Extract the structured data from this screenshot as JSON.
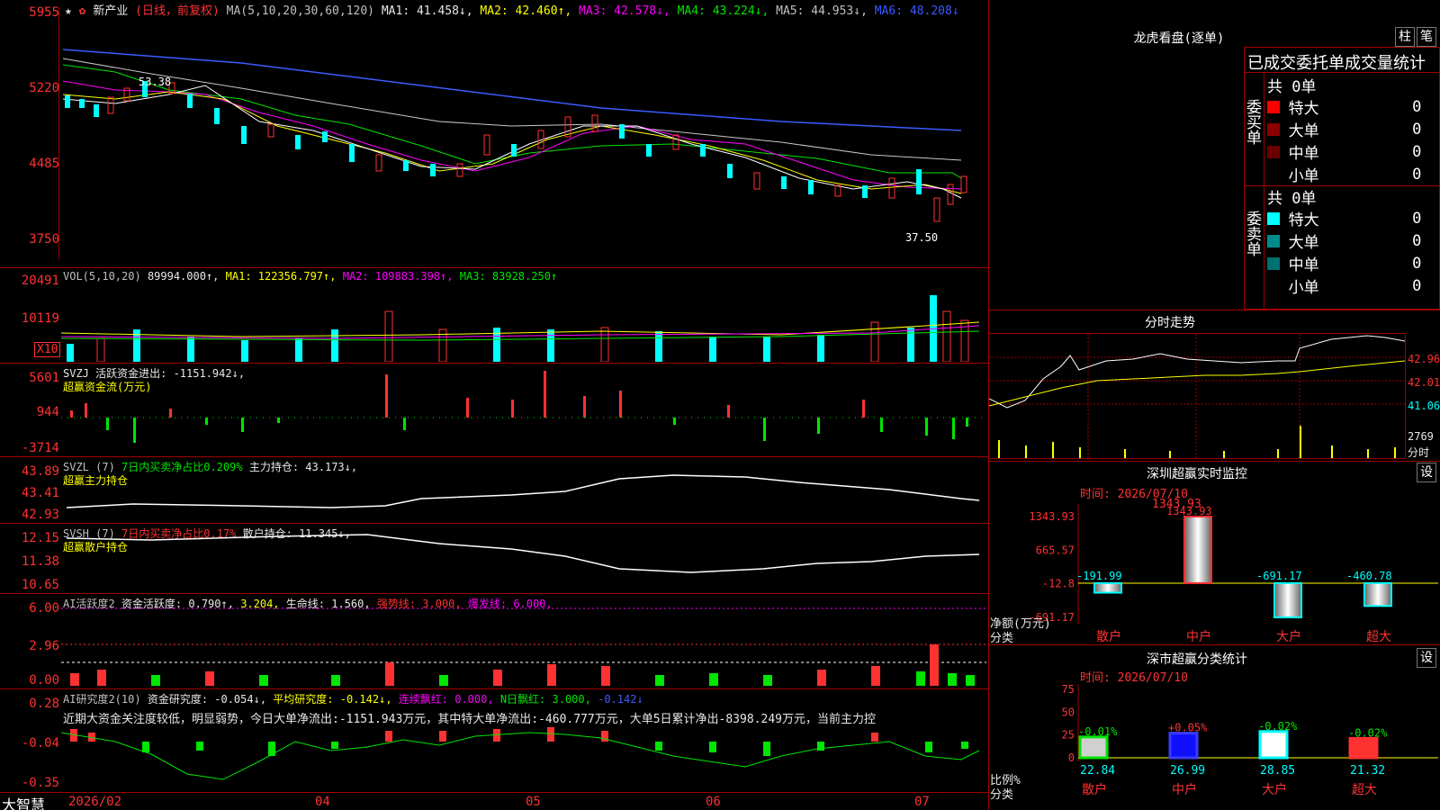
{
  "main_chart": {
    "star_icon": "★",
    "flag_icon": "✿",
    "stock_name": "新产业",
    "period": "(日线，前复权)",
    "ma_label": "MA(5,10,20,30,60,120)",
    "ma1": "MA1: 41.458↓,",
    "ma2": "MA2: 42.460↑,",
    "ma3": "MA3: 42.578↓,",
    "ma4": "MA4: 43.224↓,",
    "ma5": "MA5: 44.953↓,",
    "ma6": "MA6: 48.208↓",
    "y_ticks": [
      "5955",
      "5220",
      "4485",
      "3750"
    ],
    "high_mark": "53.38",
    "low_mark": "37.50"
  },
  "vol": {
    "label": "VOL(5,10,20)",
    "value": "89994.000↑,",
    "ma1": "MA1: 122356.797↑,",
    "ma2": "MA2: 109883.398↑,",
    "ma3": "MA3: 83928.250↑",
    "y_ticks": [
      "20491",
      "10119"
    ],
    "unit": "X10"
  },
  "svzj": {
    "label": "SVZJ  活跃资金进出: -1151.942↓,",
    "name": "超赢资金流(万元)",
    "y_ticks": [
      "5601",
      "944",
      "-3714"
    ]
  },
  "svzl": {
    "label": "SVZL (7)",
    "pct": "7日内买卖净占比0.209%",
    "hold": "主力持仓: 43.173↓,",
    "name": "超赢主力持仓",
    "y_ticks": [
      "43.89",
      "43.41",
      "42.93"
    ]
  },
  "svsh": {
    "label": "SVSH (7)",
    "pct": "7日内买卖净占比0.17%",
    "hold": "散户持仓: 11.345↓,",
    "name": "超赢散户持仓",
    "y_ticks": [
      "12.15",
      "11.38",
      "10.65"
    ]
  },
  "ai_active": {
    "label": "AI活跃度2",
    "active": "资金活跃度: 0.790↑,",
    "v2": "3.204,",
    "life": "生命线: 1.560,",
    "strong": "强势线: 3.000,",
    "burst": "爆发线: 6.000,",
    "y_ticks": [
      "6.00",
      "2.96",
      "0.00"
    ]
  },
  "ai_research": {
    "label": "AI研究度2(10)",
    "research": "资金研究度: -0.054↓,",
    "avg": "平均研究度: -0.142↓,",
    "cont": "连续飘红: 0.000,",
    "nday": "N日飘红: 3.000,",
    "last": "-0.142↓",
    "comment": "近期大资金关注度较低，明显弱势，今日大单净流出:-1151.943万元，其中特大单净流出:-460.777万元，大单5日累计净出-8398.249万元，当前主力控",
    "y_ticks": [
      "0.28",
      "-0.04",
      "-0.35"
    ]
  },
  "x_axis": {
    "brand": "大智慧",
    "labels": [
      "2026/02",
      "04",
      "05",
      "06",
      "07"
    ]
  },
  "right_panel": {
    "dragon_title": "龙虎看盘(逐单)",
    "btn_bar": "柱",
    "btn_pen": "笔",
    "stats_title": "已成交委托单成交量统计",
    "buy_side": "委买单",
    "sell_side": "委卖单",
    "buy_total": "共 0单",
    "sell_total": "共 0单",
    "buy_rows": [
      {
        "label": "特大",
        "num": "0",
        "pct": "0%",
        "color": "#ff0000"
      },
      {
        "label": "大单",
        "num": "0",
        "pct": "0%",
        "color": "#8b0000"
      },
      {
        "label": "中单",
        "num": "0",
        "pct": "0%",
        "color": "#6b0000"
      },
      {
        "label": "小单",
        "num": "0",
        "pct": "0%",
        "color": "#000000"
      }
    ],
    "sell_rows": [
      {
        "label": "特大",
        "num": "0",
        "pct": "0%",
        "color": "#00ffff"
      },
      {
        "label": "大单",
        "num": "0",
        "pct": "0%",
        "color": "#008b8b"
      },
      {
        "label": "中单",
        "num": "0",
        "pct": "0%",
        "color": "#007070"
      },
      {
        "label": "小单",
        "num": "0",
        "pct": "0%",
        "color": "#000000"
      }
    ],
    "intraday_title": "分时走势",
    "intraday_ticks": [
      "42.96",
      "42.01",
      "41.06"
    ],
    "intraday_vol": "2769",
    "intraday_vol_unit": "分时",
    "sz_monitor_title": "深圳超赢实时监控",
    "sz_monitor_btn": "设",
    "sz_time": "时间: 2026/07/10",
    "sz_top": "1343.93",
    "sz_ticks": [
      "1343.93",
      "665.57",
      "-12.8",
      "-691.17"
    ],
    "sz_ylabel": "净额(万元)",
    "sz_xlabel": "分类",
    "sz_cats": [
      "散户",
      "中户",
      "大户",
      "超大"
    ],
    "sz_values": [
      "-191.99",
      "1343.93",
      "-691.17",
      "-460.78"
    ],
    "cls_title": "深市超赢分类统计",
    "cls_btn": "设",
    "cls_time": "时间: 2026/07/10",
    "cls_ticks": [
      "75",
      "50",
      "25",
      "0"
    ],
    "cls_ylabel": "比例%",
    "cls_xlabel": "分类",
    "cls_cats": [
      "散户",
      "中户",
      "大户",
      "超大"
    ],
    "cls_changes": [
      "-0.01%",
      "+0.05%",
      "-0.02%",
      "-0.02%"
    ],
    "cls_values": [
      "22.84",
      "26.99",
      "28.85",
      "21.32"
    ]
  },
  "chart_data": [
    {
      "type": "bar",
      "title": "深圳超赢实时监控",
      "ylabel": "净额(万元)",
      "xlabel": "分类",
      "categories": [
        "散户",
        "中户",
        "大户",
        "超大"
      ],
      "values": [
        -191.99,
        1343.93,
        -691.17,
        -460.78
      ],
      "ylim": [
        -691.17,
        1343.93
      ]
    },
    {
      "type": "bar",
      "title": "深市超赢分类统计",
      "ylabel": "比例%",
      "xlabel": "分类",
      "categories": [
        "散户",
        "中户",
        "大户",
        "超大"
      ],
      "values": [
        22.84,
        26.99,
        28.85,
        21.32
      ],
      "ylim": [
        0,
        75
      ]
    }
  ]
}
